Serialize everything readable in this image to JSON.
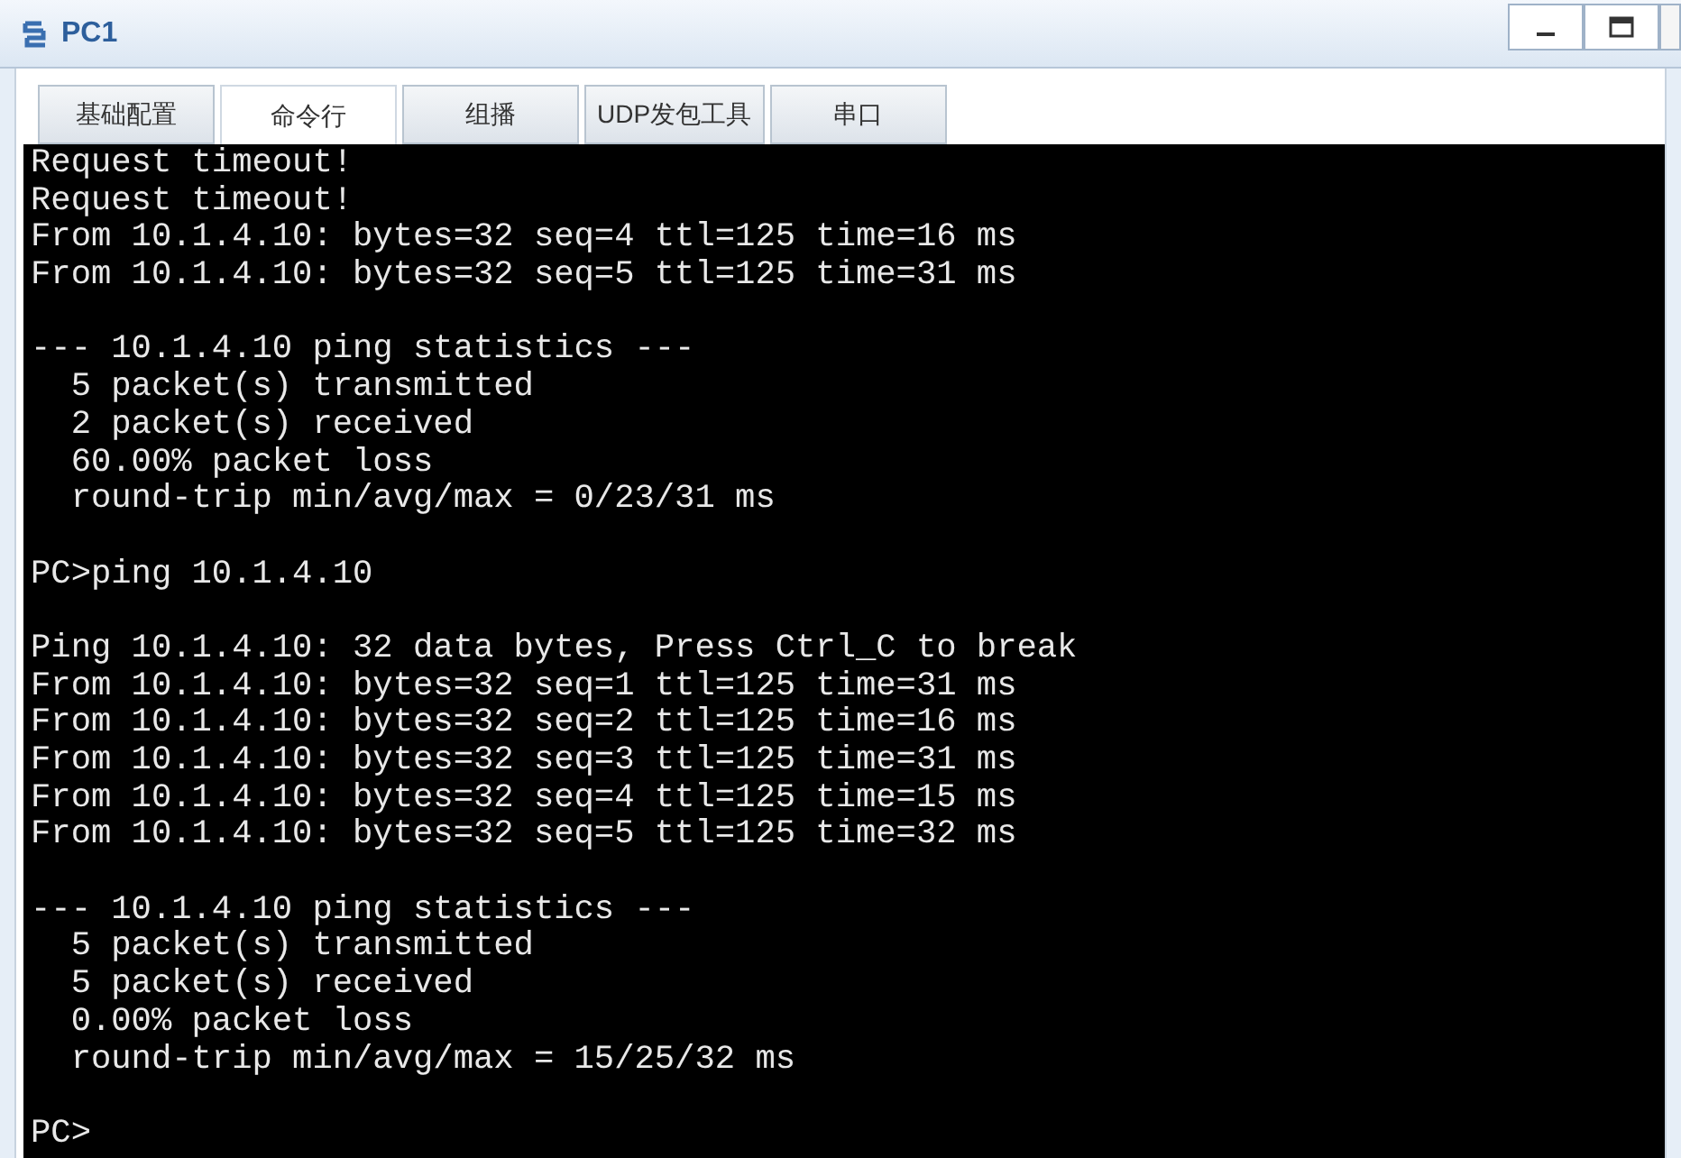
{
  "window": {
    "title": "PC1"
  },
  "tabs": [
    {
      "label": "基础配置",
      "selected": false
    },
    {
      "label": "命令行",
      "selected": true
    },
    {
      "label": "组播",
      "selected": false
    },
    {
      "label": "UDP发包工具",
      "selected": false
    },
    {
      "label": "串口",
      "selected": false
    }
  ],
  "terminal": {
    "lines": [
      {
        "kind": "text",
        "text": "Request timeout!"
      },
      {
        "kind": "text",
        "text": "Request timeout!"
      },
      {
        "kind": "text",
        "text": "From 10.1.4.10: bytes=32 seq=4 ttl=125 time=16 ms"
      },
      {
        "kind": "text",
        "text": "From 10.1.4.10: bytes=32 seq=5 ttl=125 time=31 ms"
      },
      {
        "kind": "blank"
      },
      {
        "kind": "text",
        "text": "--- 10.1.4.10 ping statistics ---"
      },
      {
        "kind": "text",
        "text": "  5 packet(s) transmitted"
      },
      {
        "kind": "text",
        "text": "  2 packet(s) received"
      },
      {
        "kind": "text",
        "text": "  60.00% packet loss"
      },
      {
        "kind": "text",
        "text": "  round-trip min/avg/max = 0/23/31 ms"
      },
      {
        "kind": "blank"
      },
      {
        "kind": "text",
        "text": "PC>ping 10.1.4.10"
      },
      {
        "kind": "blank"
      },
      {
        "kind": "text",
        "text": "Ping 10.1.4.10: 32 data bytes, Press Ctrl_C to break"
      },
      {
        "kind": "text",
        "text": "From 10.1.4.10: bytes=32 seq=1 ttl=125 time=31 ms"
      },
      {
        "kind": "text",
        "text": "From 10.1.4.10: bytes=32 seq=2 ttl=125 time=16 ms"
      },
      {
        "kind": "text",
        "text": "From 10.1.4.10: bytes=32 seq=3 ttl=125 time=31 ms"
      },
      {
        "kind": "text",
        "text": "From 10.1.4.10: bytes=32 seq=4 ttl=125 time=15 ms"
      },
      {
        "kind": "text",
        "text": "From 10.1.4.10: bytes=32 seq=5 ttl=125 time=32 ms"
      },
      {
        "kind": "blank"
      },
      {
        "kind": "text",
        "text": "--- 10.1.4.10 ping statistics ---"
      },
      {
        "kind": "text",
        "text": "  5 packet(s) transmitted"
      },
      {
        "kind": "text",
        "text": "  5 packet(s) received"
      },
      {
        "kind": "text",
        "text": "  0.00% packet loss"
      },
      {
        "kind": "text",
        "text": "  round-trip min/avg/max = 15/25/32 ms"
      },
      {
        "kind": "blank"
      },
      {
        "kind": "text",
        "text": "PC>"
      }
    ]
  }
}
